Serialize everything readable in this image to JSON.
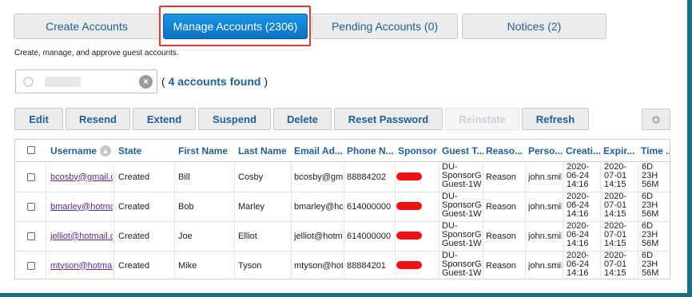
{
  "tabs": [
    {
      "label": "Create Accounts",
      "active": false
    },
    {
      "label": "Manage Accounts (2306)",
      "active": true
    },
    {
      "label": "Pending Accounts (0)",
      "active": false
    },
    {
      "label": "Notices (2)",
      "active": false
    }
  ],
  "description": "Create, manage, and approve guest accounts.",
  "search": {
    "value": "",
    "placeholder": ""
  },
  "results": {
    "open": "(",
    "count": "4 accounts found",
    "close": ")"
  },
  "toolbar": {
    "edit": "Edit",
    "resend": "Resend",
    "extend": "Extend",
    "suspend": "Suspend",
    "delete": "Delete",
    "reset_password": "Reset Password",
    "reinstate": "Reinstate",
    "refresh": "Refresh"
  },
  "table": {
    "columns": [
      "Username",
      "State",
      "First Name",
      "Last Name",
      "Email Ad...",
      "Phone N...",
      "Sponsor",
      "Guest T...",
      "Reaso...",
      "Perso...",
      "Creati...",
      "Expir...",
      "Time ..."
    ],
    "rows": [
      {
        "username": "bcosby@gmail.c",
        "state": "Created",
        "first": "Bill",
        "last": "Cosby",
        "email": "bcosby@gma",
        "phone": "88884202",
        "guest_type": "DU-\nSponsorG\nGuest-1W",
        "reason": "Reason",
        "person": "john.smil",
        "created": "2020-\n06-24\n14:16",
        "expires": "2020-\n07-01\n14:15",
        "time": "6D\n23H\n56M"
      },
      {
        "username": "bmarley@hotma",
        "state": "Created",
        "first": "Bob",
        "last": "Marley",
        "email": "bmarley@hot",
        "phone": "614000000",
        "guest_type": "DU-\nSponsorG\nGuest-1W",
        "reason": "Reason",
        "person": "john.smil",
        "created": "2020-\n06-24\n14:16",
        "expires": "2020-\n07-01\n14:15",
        "time": "6D\n23H\n56M"
      },
      {
        "username": "jelliot@hotmail.c",
        "state": "Created",
        "first": "Joe",
        "last": "Elliot",
        "email": "jelliot@hotm",
        "phone": "614000000",
        "guest_type": "DU-\nSponsorG\nGuest-1W",
        "reason": "Reason",
        "person": "john.smil",
        "created": "2020-\n06-24\n14:16",
        "expires": "2020-\n07-01\n14:15",
        "time": "6D\n23H\n56M"
      },
      {
        "username": "mtyson@hotmail",
        "state": "Created",
        "first": "Mike",
        "last": "Tyson",
        "email": "mtyson@hot",
        "phone": "88884201",
        "guest_type": "DU-\nSponsorG\nGuest-1W",
        "reason": "Reason",
        "person": "john.smil",
        "created": "2020-\n06-24\n14:16",
        "expires": "2020-\n07-01\n14:15",
        "time": "6D\n23H\n56M"
      }
    ]
  },
  "colors": {
    "accent": "#1f5f99",
    "active_tab": "#0d70c4",
    "highlight": "#e53935",
    "redaction": "#ee1111",
    "link_visited": "#5b2b91",
    "frame": "#1b6f85"
  }
}
